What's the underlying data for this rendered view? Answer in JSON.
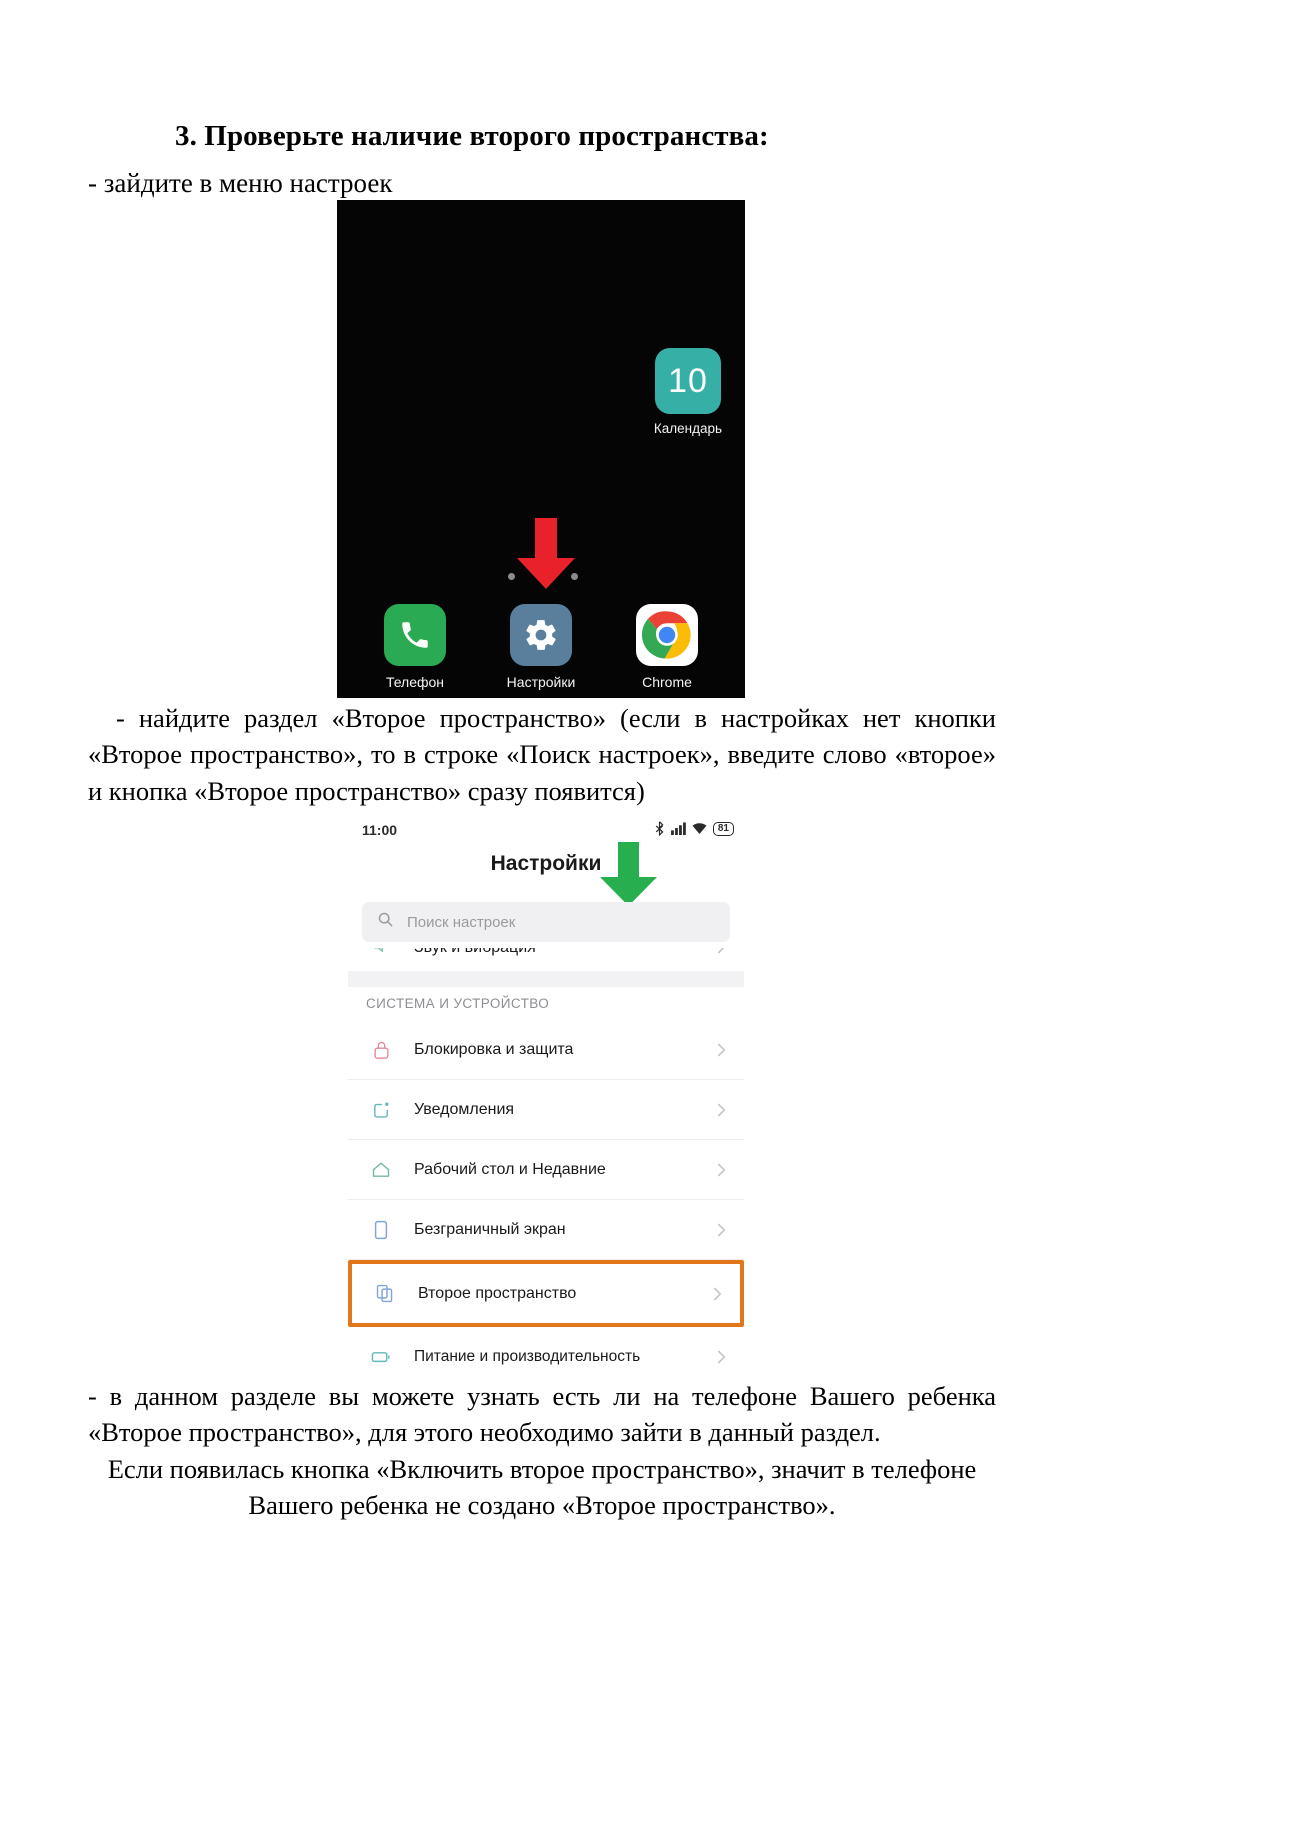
{
  "document": {
    "heading": "3. Проверьте наличие второго пространства:",
    "line_1": "- зайдите в меню настроек",
    "paragraph_2": "- найдите раздел «Второе пространство» (если в настройках нет кнопки «Второе пространство», то в строке «Поиск настроек», введите слово «второе» и кнопка «Второе пространство» сразу появится)",
    "paragraph_3_line1": "- в данном разделе вы можете узнать есть ли на телефоне Вашего ребенка «Второе пространство», для этого необходимо зайти в данный раздел.",
    "paragraph_3_line2": "Если появилась кнопка «Включить второе пространство», значит в телефоне",
    "paragraph_3_line3": "Вашего ребенка не создано «Второе пространство»."
  },
  "home_screen": {
    "calendar": {
      "day_number": "10",
      "label": "Календарь",
      "color": "#36b0a6"
    },
    "dock": [
      {
        "label": "Телефон",
        "icon": "phone-icon",
        "color": "#2aab53"
      },
      {
        "label": "Настройки",
        "icon": "gear-icon",
        "color": "#5a7f9c"
      },
      {
        "label": "Chrome",
        "icon": "chrome-icon",
        "color": "#ffffff"
      }
    ],
    "arrow": {
      "icon": "down-arrow-icon",
      "color": "#e8212b"
    }
  },
  "settings_screen": {
    "status_bar": {
      "time": "11:00",
      "battery": "81",
      "icons": [
        "bluetooth-icon",
        "signal-icon",
        "wifi-icon",
        "battery-icon"
      ]
    },
    "title": "Настройки",
    "arrow": {
      "icon": "down-arrow-icon",
      "color": "#27ae4f"
    },
    "search": {
      "placeholder": "Поиск настроек",
      "icon": "search-icon"
    },
    "partial_row": {
      "label": "Звук и вибрация",
      "icon": "sound-icon"
    },
    "section_header": "СИСТЕМА И УСТРОЙСТВО",
    "rows": [
      {
        "label": "Блокировка и защита",
        "icon": "lock-icon",
        "icon_color": "#e08a96",
        "highlighted": false,
        "two_line": false
      },
      {
        "label": "Уведомления",
        "icon": "notification-icon",
        "icon_color": "#63b8b8",
        "highlighted": false,
        "two_line": false
      },
      {
        "label": "Рабочий стол и Недавние",
        "icon": "home-icon",
        "icon_color": "#74b9a8",
        "highlighted": false,
        "two_line": false
      },
      {
        "label": "Безграничный экран",
        "icon": "screen-icon",
        "icon_color": "#7fa6d9",
        "highlighted": false,
        "two_line": false
      },
      {
        "label": "Второе пространство",
        "icon": "copy-icon",
        "icon_color": "#7fa6d9",
        "highlighted": true,
        "two_line": false
      },
      {
        "label": "Питание и производительность",
        "icon": "battery-perf-icon",
        "icon_color": "#63b8b8",
        "highlighted": false,
        "two_line": true
      }
    ],
    "highlight_color": "#e2761b"
  }
}
